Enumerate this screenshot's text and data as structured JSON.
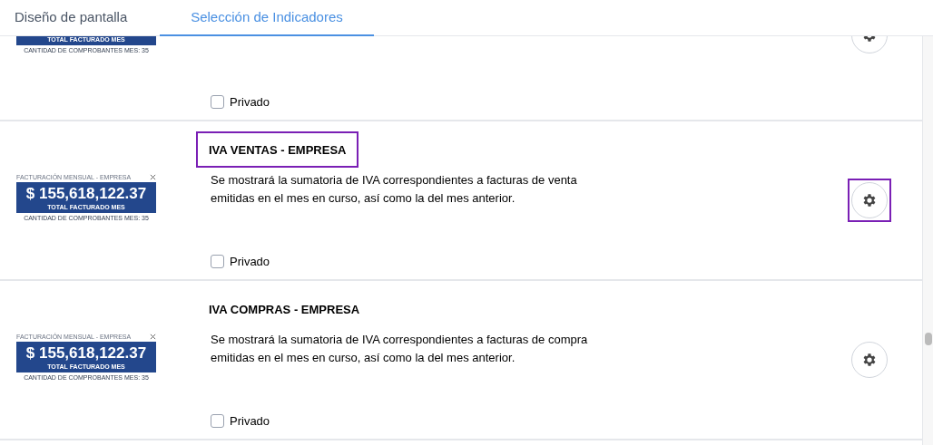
{
  "tabs": [
    {
      "label": "Diseño de pantalla",
      "selected": false
    },
    {
      "label": "Selección de Indicadores",
      "selected": true
    }
  ],
  "indicators": [
    {
      "thumbnail": {
        "subtitle": "TOTAL FACTURADO MES",
        "footer": "CANTIDAD DE COMPROBANTES MES: 35"
      },
      "private_label": "Privado",
      "private": false,
      "settings_highlighted": false
    },
    {
      "title": "IVA VENTAS - EMPRESA",
      "title_highlighted": true,
      "description": "Se mostrará la sumatoria de IVA correspondientes a facturas de venta emitidas en el mes en curso, así como la del mes anterior.",
      "thumbnail": {
        "heading": "FACTURACIÓN MENSUAL - EMPRESA",
        "amount": "$ 155,618,122.37",
        "subtitle": "TOTAL FACTURADO MES",
        "footer": "CANTIDAD DE COMPROBANTES MES: 35"
      },
      "private_label": "Privado",
      "private": false,
      "settings_highlighted": true
    },
    {
      "title": "IVA COMPRAS - EMPRESA",
      "title_highlighted": false,
      "description": "Se mostrará la sumatoria de IVA correspondientes a facturas de compra emitidas en el mes en curso, así como la del mes anterior.",
      "thumbnail": {
        "heading": "FACTURACIÓN MENSUAL - EMPRESA",
        "amount": "$ 155,618,122.37",
        "subtitle": "TOTAL FACTURADO MES",
        "footer": "CANTIDAD DE COMPROBANTES MES: 35"
      },
      "private_label": "Privado",
      "private": false,
      "settings_highlighted": false
    }
  ]
}
